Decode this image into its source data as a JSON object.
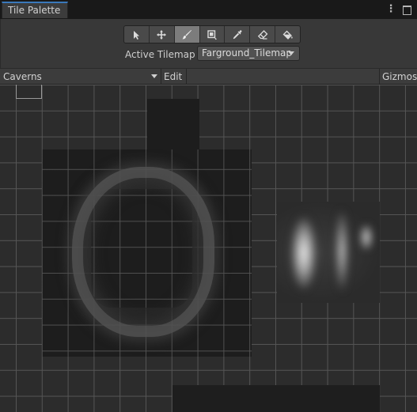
{
  "window": {
    "tab_title": "Tile Palette",
    "menu_glyph": "⋮"
  },
  "toolbar": {
    "tools": [
      {
        "name": "select",
        "icon": "arrow-cursor-icon",
        "active": false
      },
      {
        "name": "move",
        "icon": "move-arrows-icon",
        "active": false
      },
      {
        "name": "paint",
        "icon": "paintbrush-icon",
        "active": true
      },
      {
        "name": "box-fill",
        "icon": "box-fill-icon",
        "active": false
      },
      {
        "name": "pick",
        "icon": "eyedropper-icon",
        "active": false
      },
      {
        "name": "erase",
        "icon": "eraser-icon",
        "active": false
      },
      {
        "name": "flood-fill",
        "icon": "paint-bucket-icon",
        "active": false
      }
    ],
    "active_tilemap_label": "Active Tilemap",
    "active_tilemap_value": "Farground_Tilemap"
  },
  "palette_bar": {
    "palette_name": "Caverns",
    "edit_label": "Edit",
    "gizmos_label": "Gizmos"
  },
  "colors": {
    "accent": "#3a79bb",
    "panel": "#383838",
    "grid_bg": "#2c2c2c",
    "grid_line": "#555555",
    "active_tool": "#7c7c7c"
  }
}
